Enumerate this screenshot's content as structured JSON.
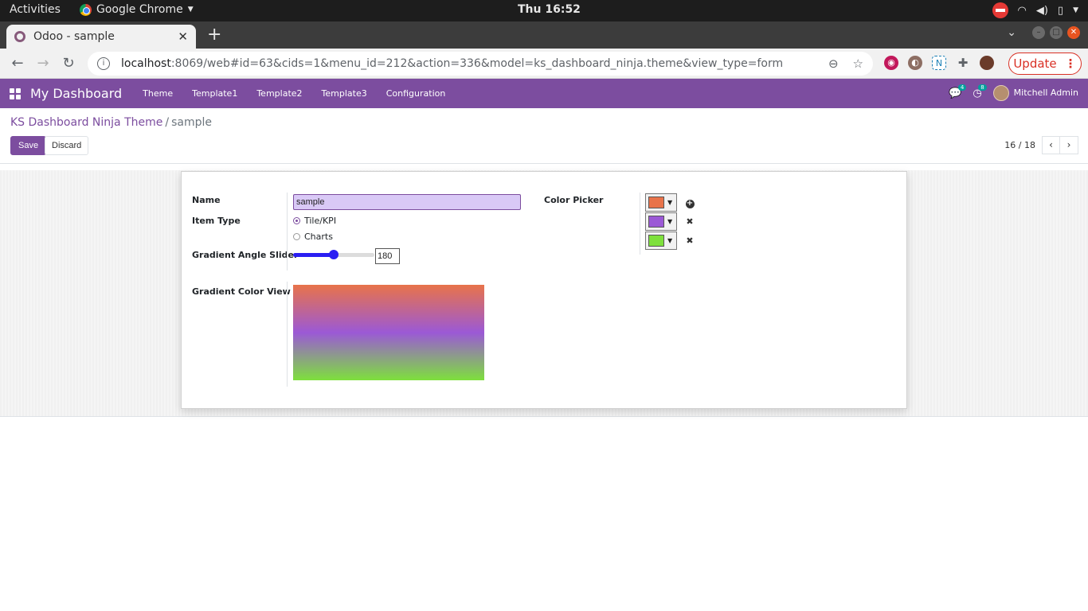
{
  "os_bar": {
    "activities": "Activities",
    "app_name": "Google Chrome",
    "clock": "Thu 16:52"
  },
  "browser": {
    "tab_title": "Odoo - sample",
    "url_host": "localhost",
    "url_rest": ":8069/web#id=63&cids=1&menu_id=212&action=336&model=ks_dashboard_ninja.theme&view_type=form",
    "update_label": "Update"
  },
  "odoo_nav": {
    "brand": "My Dashboard",
    "menu": [
      "Theme",
      "Template1",
      "Template2",
      "Template3",
      "Configuration"
    ],
    "messages_count": "4",
    "activities_count": "8",
    "user_name": "Mitchell Admin",
    "accent_color": "#7c4d9f"
  },
  "control_panel": {
    "breadcrumb_parent": "KS Dashboard Ninja Theme",
    "breadcrumb_separator": "/",
    "breadcrumb_current": "sample",
    "save_label": "Save",
    "discard_label": "Discard",
    "pager_value": "16 / 18"
  },
  "form": {
    "name_label": "Name",
    "name_value": "sample",
    "item_type_label": "Item Type",
    "item_type_options": [
      {
        "label": "Tile/KPI",
        "checked": true
      },
      {
        "label": "Charts",
        "checked": false
      }
    ],
    "gradient_angle_label": "Gradient Angle Slider",
    "gradient_angle_value": "180",
    "gradient_angle_max": 360,
    "gradient_color_label": "Gradient Color View",
    "color_picker_label": "Color Picker",
    "colors": [
      "#e8734a",
      "#9b59d6",
      "#7ee03c"
    ]
  }
}
